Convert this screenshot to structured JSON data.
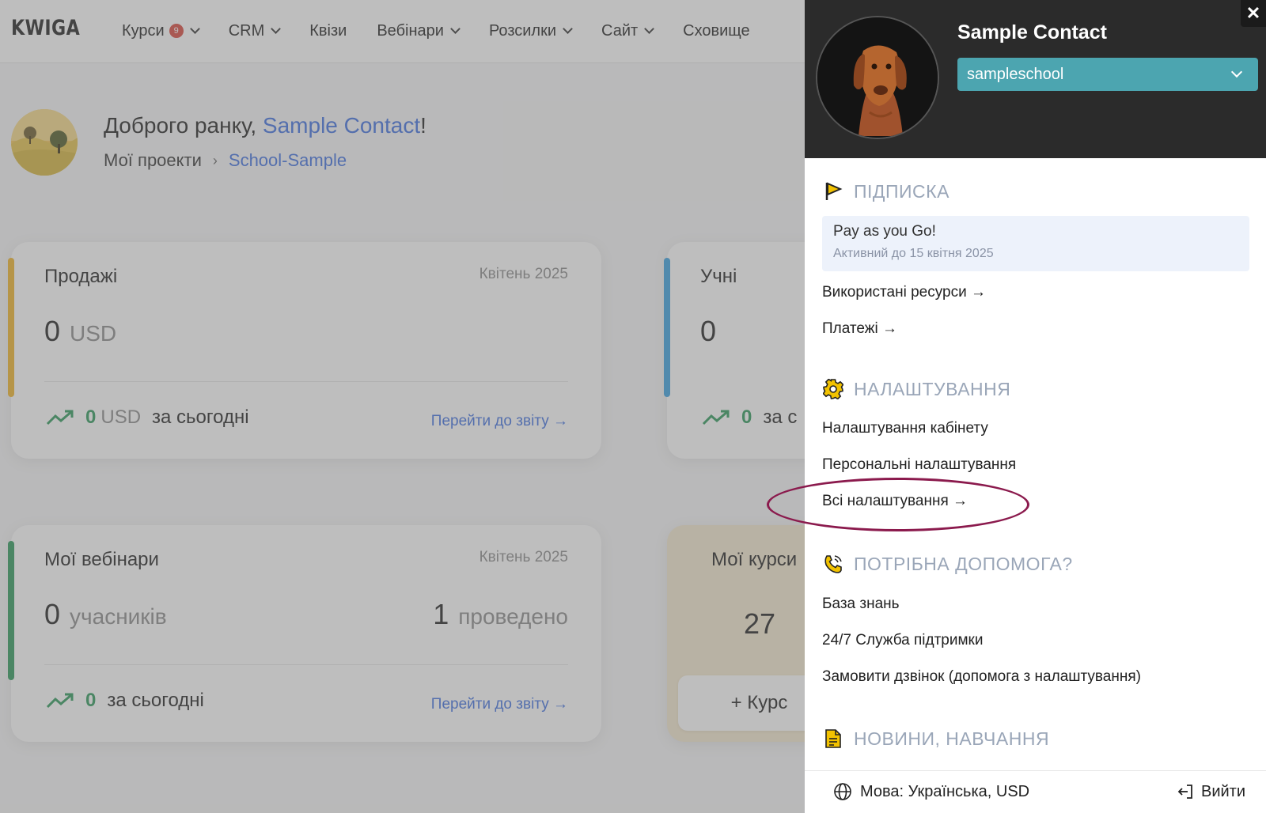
{
  "app": {
    "logo": "KWIGA"
  },
  "nav": [
    {
      "label": "Курси",
      "badge": "9",
      "dropdown": true
    },
    {
      "label": "CRM",
      "dropdown": true
    },
    {
      "label": "Квізи",
      "dropdown": false
    },
    {
      "label": "Вебінари",
      "dropdown": true
    },
    {
      "label": "Розсилки",
      "dropdown": true
    },
    {
      "label": "Сайт",
      "dropdown": true
    },
    {
      "label": "Сховище",
      "dropdown": false
    }
  ],
  "greeting": {
    "prefix": "Доброго ранку, ",
    "name": "Sample Contact",
    "suffix": "!"
  },
  "breadcrumb": {
    "root": "Мої проекти",
    "separator": "›",
    "current": "School-Sample"
  },
  "cards": {
    "sales": {
      "title": "Продажі",
      "date": "Квітень 2025",
      "value": "0",
      "unit": "USD",
      "today_value": "0",
      "today_unit": "USD",
      "today_label": "за сьогодні",
      "report": "Перейти до звіту →",
      "stripe_color": "#f0b429"
    },
    "students": {
      "title": "Учні",
      "value": "0",
      "today_value": "0",
      "today_label": "за с",
      "stripe_color": "#3aa0e0"
    },
    "webinars": {
      "title": "Мої вебінари",
      "date": "Квітень 2025",
      "value": "0",
      "unit": "учасників",
      "held_value": "1",
      "held_unit": "проведено",
      "today_value": "0",
      "today_label": "за сьогодні",
      "report": "Перейти до звіту →",
      "stripe_color": "#2e9a5b"
    },
    "courses": {
      "title": "Мої курси",
      "value": "27",
      "add_button": "+ Курс"
    }
  },
  "panel": {
    "name": "Sample Contact",
    "school_select": "sampleschool",
    "close": "✕",
    "subscription": {
      "title": "ПІДПИСКА",
      "plan_name": "Pay as you Go!",
      "plan_active": "Активний до 15 квітня 2025",
      "links": [
        "Використані ресурси →",
        "Платежі →"
      ]
    },
    "settings": {
      "title": "НАЛАШТУВАННЯ",
      "links": [
        "Налаштування кабінету",
        "Персональні налаштування",
        "Всі налаштування →"
      ]
    },
    "help": {
      "title": "ПОТРІБНА ДОПОМОГА?",
      "links": [
        "База знань",
        "24/7 Служба підтримки",
        "Замовити дзвінок (допомога з налаштування)"
      ]
    },
    "news": {
      "title": "НОВИНИ, НАВЧАННЯ"
    },
    "footer": {
      "language": "Мова: Українська, USD",
      "logout": "Вийти"
    }
  },
  "colors": {
    "accent": "#3f6fe0",
    "positive": "#2e9a5b",
    "select_bg": "#4ca5b0",
    "panel_header": "#2b2b2b",
    "highlight": "#8b1a4d",
    "icon_yellow": "#f2c200"
  }
}
